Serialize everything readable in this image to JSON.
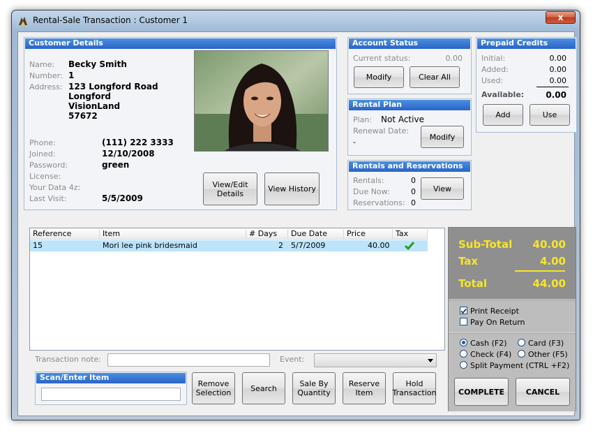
{
  "window": {
    "title": "Rental-Sale Transaction : Customer 1",
    "close_glyph": "x"
  },
  "customer": {
    "header": "Customer Details",
    "name_label": "Name:",
    "name": "Becky Smith",
    "number_label": "Number:",
    "number": "1",
    "address_label": "Address:",
    "address_line1": "123 Longford Road",
    "address_line2": "Longford",
    "address_line3": "VisionLand",
    "address_line4": "57672",
    "phone_label": "Phone:",
    "phone": "(111) 222 3333",
    "joined_label": "Joined:",
    "joined": "12/10/2008",
    "password_label": "Password:",
    "password": "green",
    "license_label": "License:",
    "license": "",
    "yourdata_label": "Your Data 4z:",
    "yourdata": "",
    "lastvisit_label": "Last Visit:",
    "lastvisit": "5/5/2009",
    "view_edit_label_line1": "View/Edit",
    "view_edit_label_line2": "Details",
    "view_history_label": "View History"
  },
  "account_status": {
    "header": "Account Status",
    "current_label": "Current status:",
    "current_value": "0.00",
    "modify_label": "Modify",
    "clear_label": "Clear All"
  },
  "prepaid": {
    "header": "Prepaid Credits",
    "initial_label": "Initial:",
    "initial": "0.00",
    "added_label": "Added:",
    "added": "0.00",
    "used_label": "Used:",
    "used": "0.00",
    "available_label": "Available:",
    "available": "0.00",
    "add_label": "Add",
    "use_label": "Use"
  },
  "rental_plan": {
    "header": "Rental Plan",
    "plan_label": "Plan:",
    "plan": "Not Active",
    "renewal_label": "Renewal Date:",
    "renewal": "-",
    "modify_label": "Modify"
  },
  "rentals": {
    "header": "Rentals and Reservations",
    "rentals_label": "Rentals:",
    "rentals": "0",
    "due_label": "Due Now:",
    "due": "0",
    "reservations_label": "Reservations:",
    "reservations": "0",
    "view_label": "View"
  },
  "table": {
    "columns": [
      "Reference",
      "Item",
      "# Days",
      "Due Date",
      "Price",
      "Tax"
    ],
    "rows": [
      {
        "reference": "15",
        "item": "Mori lee pink bridesmaid",
        "days": "2",
        "due": "5/7/2009",
        "price": "40.00",
        "tax": "check"
      }
    ]
  },
  "note": {
    "label": "Transaction note:",
    "value": "",
    "event_label": "Event:",
    "event_value": ""
  },
  "scan": {
    "header": "Scan/Enter Item",
    "value": ""
  },
  "actions": {
    "remove_line1": "Remove",
    "remove_line2": "Selection",
    "search": "Search",
    "sale_line1": "Sale By",
    "sale_line2": "Quantity",
    "reserve_line1": "Reserve",
    "reserve_line2": "Item",
    "hold_line1": "Hold",
    "hold_line2": "Transaction"
  },
  "totals": {
    "subtotal_label": "Sub-Total",
    "subtotal": "40.00",
    "tax_label": "Tax",
    "tax": "4.00",
    "total_label": "Total",
    "total": "44.00",
    "color": "#f7e628"
  },
  "options": {
    "print_receipt": "Print Receipt",
    "print_receipt_checked": true,
    "pay_on_return": "Pay On Return",
    "pay_on_return_checked": false
  },
  "payment": {
    "cash": "Cash (F2)",
    "card": "Card (F3)",
    "check": "Check (F4)",
    "other": "Other (F5)",
    "split": "Split Payment (CTRL +F2)",
    "selected": "cash",
    "complete": "COMPLETE",
    "cancel": "CANCEL"
  },
  "colors": {
    "header_blue": "#2a64c8",
    "row_selected": "#bde4fb"
  }
}
